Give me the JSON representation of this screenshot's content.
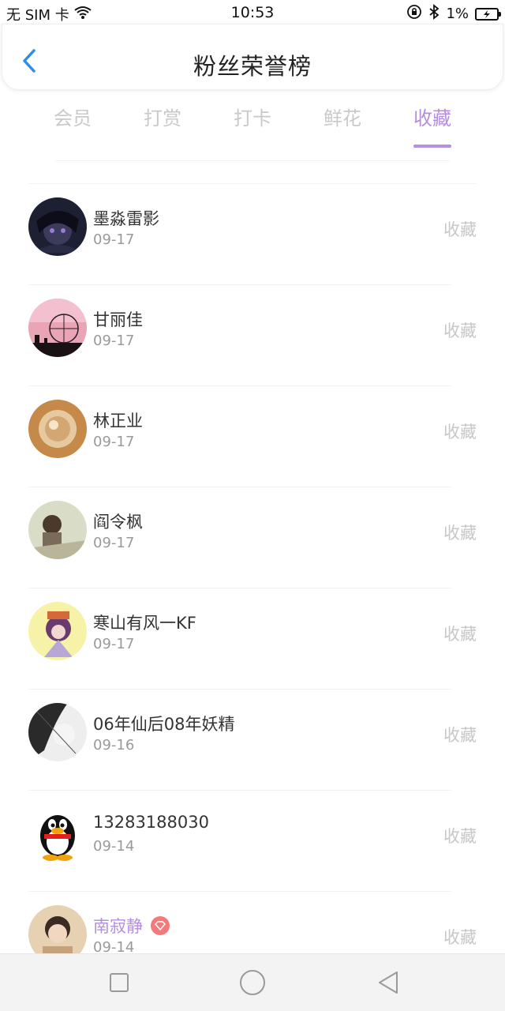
{
  "status_bar": {
    "carrier": "无 SIM 卡",
    "time": "10:53",
    "battery": "1%"
  },
  "header": {
    "title": "粉丝荣誉榜"
  },
  "tabs": [
    {
      "label": "会员"
    },
    {
      "label": "打赏"
    },
    {
      "label": "打卡"
    },
    {
      "label": "鲜花"
    },
    {
      "label": "收藏",
      "active": true
    }
  ],
  "list": [
    {
      "name": "墨淼雷影",
      "date": "09-17",
      "action": "收藏",
      "avatar": "dark-anime-avatar"
    },
    {
      "name": "甘丽佳",
      "date": "09-17",
      "action": "收藏",
      "avatar": "ferris-wheel-pink-avatar"
    },
    {
      "name": "林正业",
      "date": "09-17",
      "action": "收藏",
      "avatar": "brown-object-avatar"
    },
    {
      "name": "阎令枫",
      "date": "09-17",
      "action": "收藏",
      "avatar": "girl-illustration-avatar"
    },
    {
      "name": "寒山有风一KF",
      "date": "09-17",
      "action": "收藏",
      "avatar": "yellow-cartoon-avatar"
    },
    {
      "name": "06年仙后08年妖精",
      "date": "09-16",
      "action": "收藏",
      "avatar": "black-white-avatar"
    },
    {
      "name": "13283188030",
      "date": "09-14",
      "action": "收藏",
      "avatar": "qq-penguin-avatar"
    },
    {
      "name": "南寂静",
      "date": "09-14",
      "action": "收藏",
      "avatar": "portrait-avatar",
      "vip": true
    }
  ],
  "colors": {
    "accent": "#b58ee0",
    "back_icon": "#2f8ee5",
    "badge": "#f27a7a"
  }
}
